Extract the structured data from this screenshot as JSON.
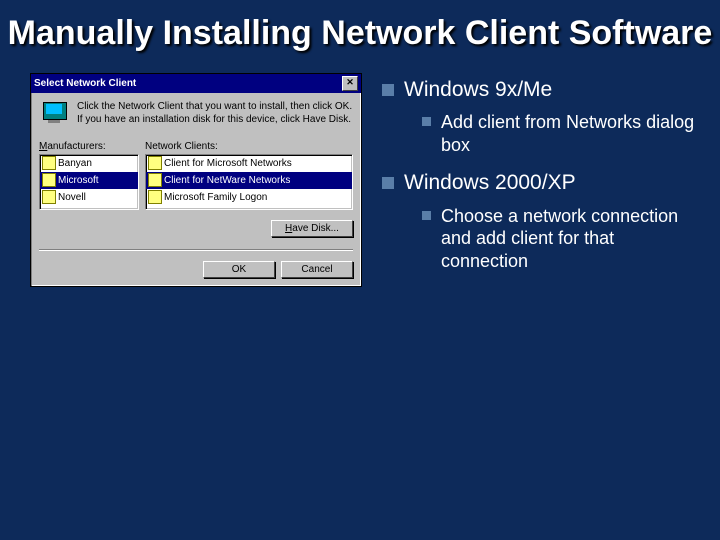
{
  "slide": {
    "title": "Manually Installing Network Client Software"
  },
  "dialog": {
    "title": "Select Network Client",
    "instruction": "Click the Network Client that you want to install, then click OK. If you have an installation disk for this device, click Have Disk.",
    "manufacturers_label": "Manufacturers:",
    "clients_label": "Network Clients:",
    "manufacturers": [
      "Banyan",
      "Microsoft",
      "Novell"
    ],
    "clients": [
      "Client for Microsoft Networks",
      "Client for NetWare Networks",
      "Microsoft Family Logon"
    ],
    "have_disk": "Have Disk...",
    "ok": "OK",
    "cancel": "Cancel"
  },
  "outline": {
    "items": [
      {
        "text": "Windows 9x/Me",
        "children": [
          {
            "text": "Add client from Networks dialog box"
          }
        ]
      },
      {
        "text": "Windows 2000/XP",
        "children": [
          {
            "text": "Choose a network connection and add client for that connection"
          }
        ]
      }
    ]
  }
}
